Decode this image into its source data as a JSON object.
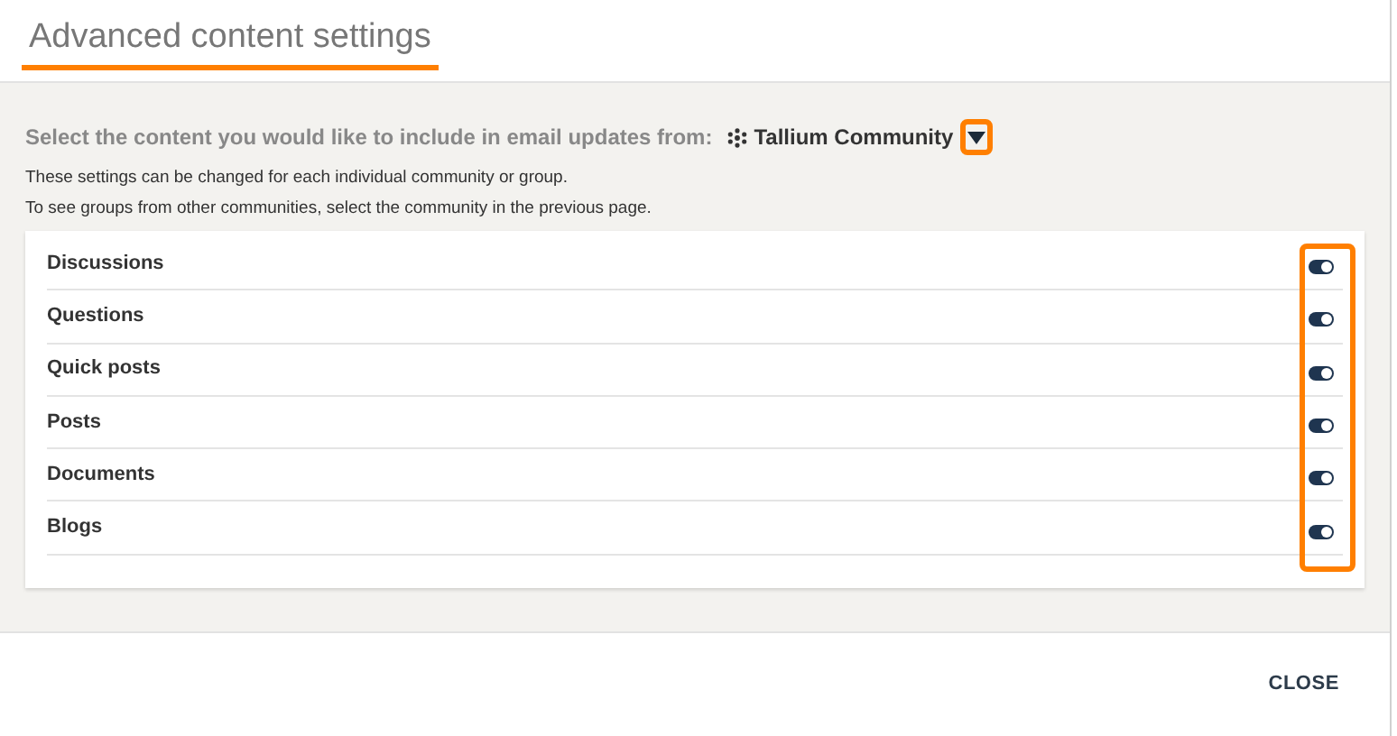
{
  "dialog": {
    "title": "Advanced content settings"
  },
  "source": {
    "prompt": "Select the content you would like to include in email updates from:",
    "community": "Tallium Community"
  },
  "notes": [
    "These settings can be changed for each individual community or group.",
    "To see groups from other communities, select the community in the previous page."
  ],
  "content_types": [
    {
      "label": "Discussions",
      "on": true
    },
    {
      "label": "Questions",
      "on": true
    },
    {
      "label": "Quick posts",
      "on": true
    },
    {
      "label": "Posts",
      "on": true
    },
    {
      "label": "Documents",
      "on": true
    },
    {
      "label": "Blogs",
      "on": true
    }
  ],
  "footer": {
    "close": "CLOSE"
  }
}
